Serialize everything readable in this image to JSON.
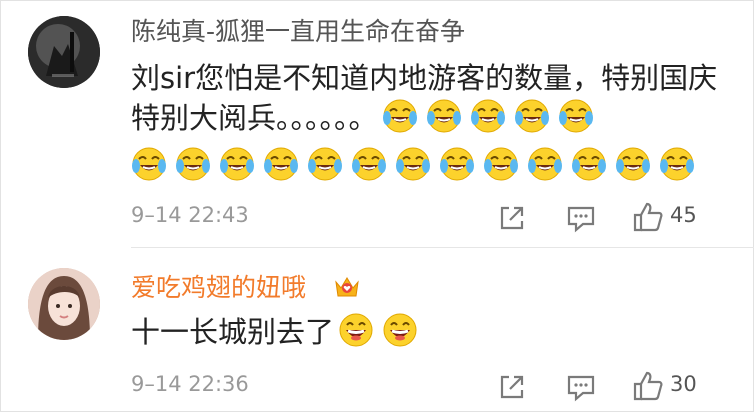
{
  "comments": [
    {
      "username": "陈纯真-狐狸一直用生命在奋争",
      "text": "刘sir您怕是不知道内地游客的数量，特别国庆特别大阅兵。。。。。。",
      "emojis": [
        "laugh-cry-emoji",
        "laugh-cry-emoji",
        "laugh-cry-emoji",
        "laugh-cry-emoji",
        "laugh-cry-emoji",
        "laugh-cry-emoji",
        "laugh-cry-emoji",
        "laugh-cry-emoji",
        "laugh-cry-emoji",
        "laugh-cry-emoji",
        "laugh-cry-emoji",
        "laugh-cry-emoji",
        "laugh-cry-emoji",
        "laugh-cry-emoji",
        "laugh-cry-emoji",
        "laugh-cry-emoji",
        "laugh-cry-emoji",
        "laugh-cry-emoji"
      ],
      "time": "9–14 22:43",
      "likes": "45"
    },
    {
      "username": "爱吃鸡翅的妞哦",
      "text": "十一长城别去了",
      "emojis": [
        "grin-emoji",
        "grin-emoji"
      ],
      "time": "9–14 22:36",
      "likes": "30"
    }
  ],
  "colors": {
    "username_default": "#555555",
    "username_vip": "#f27b2b",
    "text": "#222222",
    "meta": "#999999"
  },
  "icons": [
    "share-icon",
    "comment-icon",
    "like-icon",
    "vip-crown-icon"
  ]
}
